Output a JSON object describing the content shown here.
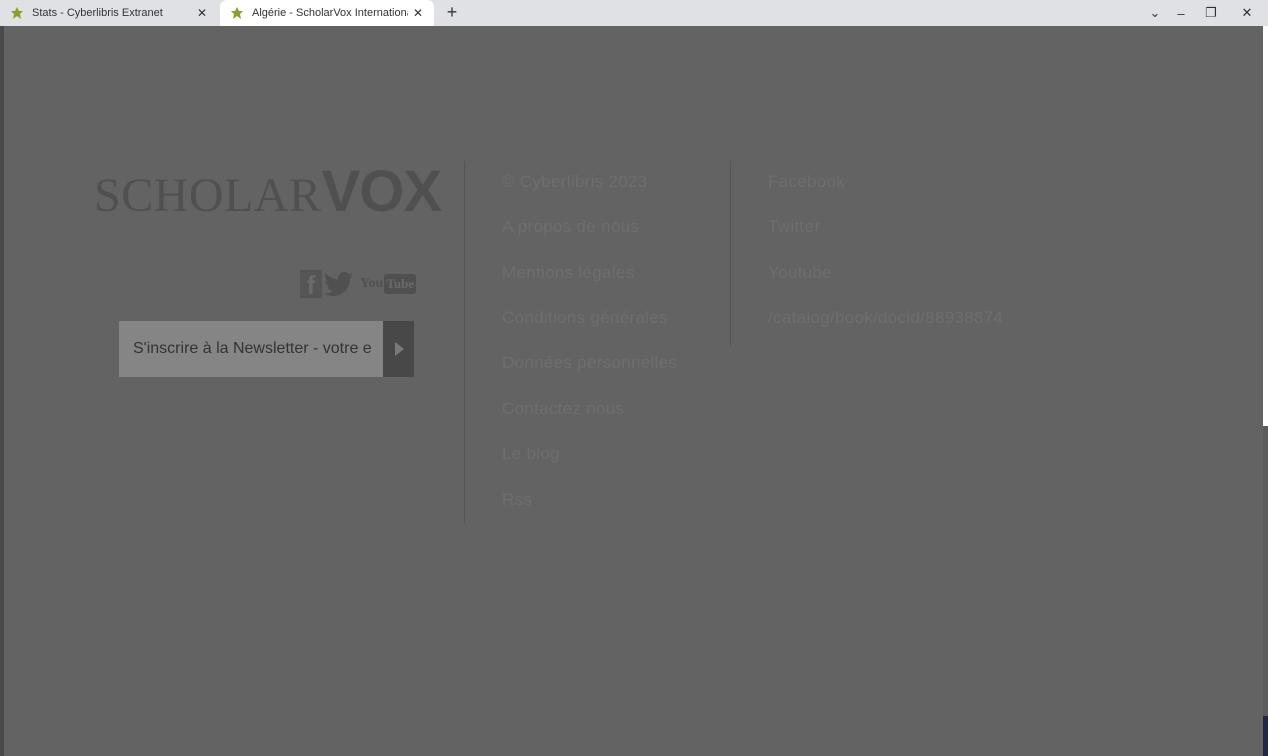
{
  "browser": {
    "tabs": [
      {
        "title": "Stats - Cyberlibris Extranet",
        "active": false
      },
      {
        "title": "Algérie - ScholarVox Internationa",
        "active": true
      }
    ],
    "new_tab": "+",
    "controls": {
      "list": "⌄",
      "minimize": "–",
      "restore": "❐",
      "close": "✕"
    }
  },
  "footer": {
    "logo": {
      "scholar": "SCHOLAR",
      "vox": "VOX"
    },
    "social_icons": [
      "facebook-icon",
      "twitter-icon",
      "youtube-icon"
    ],
    "youtube_badge": {
      "you": "You",
      "tube": "Tube"
    },
    "newsletter": {
      "placeholder": "S'inscrire à la Newsletter - votre e"
    },
    "column1": [
      "© Cyberlibris 2023",
      "A propos de nous",
      "Mentions légales",
      "Conditions générales",
      "Données personnelles",
      "Contactez nous",
      "Le blog",
      "Rss"
    ],
    "column2": [
      "Facebook",
      "Twitter",
      "Youtube",
      "/catalog/book/docid/88938874"
    ]
  },
  "colors": {
    "overlay": "#636363",
    "text_muted": "#6e6e6e",
    "logo": "#505050"
  }
}
